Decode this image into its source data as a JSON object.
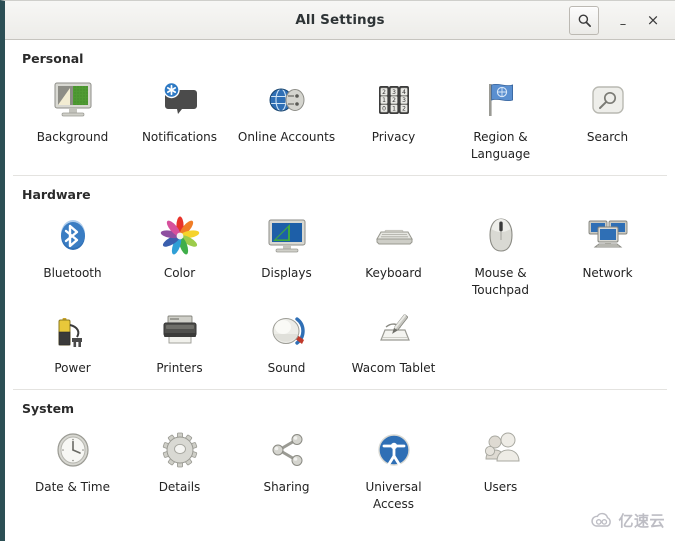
{
  "window": {
    "title": "All Settings",
    "controls": {
      "search_label": "search-icon",
      "minimize_label": "–",
      "close_label": "×"
    }
  },
  "sections": [
    {
      "id": "personal",
      "title": "Personal",
      "items": [
        {
          "id": "background",
          "label": "Background",
          "icon": "background-monitor-icon"
        },
        {
          "id": "notifications",
          "label": "Notifications",
          "icon": "notification-bubble-icon"
        },
        {
          "id": "online-accounts",
          "label": "Online\nAccounts",
          "icon": "online-accounts-globe-icon"
        },
        {
          "id": "privacy",
          "label": "Privacy",
          "icon": "privacy-lock-dials-icon"
        },
        {
          "id": "region-language",
          "label": "Region &\nLanguage",
          "icon": "region-flag-icon"
        },
        {
          "id": "search",
          "label": "Search",
          "icon": "search-magnifier-icon"
        }
      ]
    },
    {
      "id": "hardware",
      "title": "Hardware",
      "items": [
        {
          "id": "bluetooth",
          "label": "Bluetooth",
          "icon": "bluetooth-icon"
        },
        {
          "id": "color",
          "label": "Color",
          "icon": "color-wheel-icon"
        },
        {
          "id": "displays",
          "label": "Displays",
          "icon": "displays-monitor-icon"
        },
        {
          "id": "keyboard",
          "label": "Keyboard",
          "icon": "keyboard-icon"
        },
        {
          "id": "mouse-touchpad",
          "label": "Mouse &\nTouchpad",
          "icon": "mouse-icon"
        },
        {
          "id": "network",
          "label": "Network",
          "icon": "network-computers-icon"
        },
        {
          "id": "power",
          "label": "Power",
          "icon": "power-battery-icon"
        },
        {
          "id": "printers",
          "label": "Printers",
          "icon": "printer-icon"
        },
        {
          "id": "sound",
          "label": "Sound",
          "icon": "sound-speaker-icon"
        },
        {
          "id": "wacom-tablet",
          "label": "Wacom Tablet",
          "icon": "wacom-stylus-icon"
        }
      ]
    },
    {
      "id": "system",
      "title": "System",
      "items": [
        {
          "id": "date-time",
          "label": "Date & Time",
          "icon": "clock-icon"
        },
        {
          "id": "details",
          "label": "Details",
          "icon": "gear-icon"
        },
        {
          "id": "sharing",
          "label": "Sharing",
          "icon": "share-nodes-icon"
        },
        {
          "id": "universal-access",
          "label": "Universal\nAccess",
          "icon": "universal-access-icon"
        },
        {
          "id": "users",
          "label": "Users",
          "icon": "users-group-icon"
        }
      ]
    }
  ],
  "watermark": {
    "text": "亿速云",
    "icon": "cloud-logo-icon"
  },
  "colors": {
    "window_border": "#2c4f55",
    "titlebar_top": "#f7f7f5",
    "titlebar_bottom": "#edece9",
    "accent_blue": "#2f6fb5",
    "text": "#232323",
    "divider": "#e4e3e0"
  }
}
